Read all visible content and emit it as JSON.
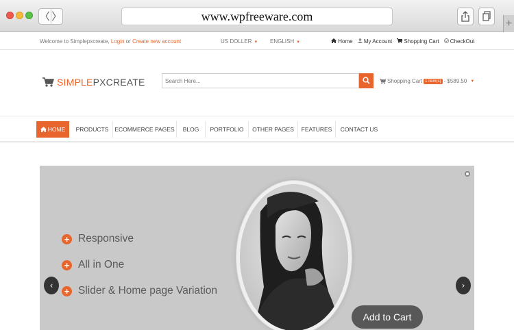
{
  "browser": {
    "url": "www.wpfreeware.com",
    "back": "〈",
    "forward": "〉",
    "new_tab": "+"
  },
  "topbar": {
    "welcome": "Welcome to Simplepxcreate,",
    "login": "Login",
    "or": "or",
    "create_account": "Create new account",
    "currency": "US DOLLER",
    "language": "ENGLISH",
    "links": [
      {
        "label": "Home",
        "icon": "home-icon"
      },
      {
        "label": "My Account",
        "icon": "user-icon"
      },
      {
        "label": "Shopping Cart",
        "icon": "cart-icon"
      },
      {
        "label": "CheckOut",
        "icon": "check-icon"
      }
    ]
  },
  "header": {
    "logo_part1": "SIMPLE",
    "logo_part2": "PXCREATE",
    "search_placeholder": "Search Here...",
    "cart_label": "Shopping Cart",
    "cart_count": "1 item(s)",
    "cart_total": "- $589.50"
  },
  "nav": {
    "items": [
      "HOME",
      "PRODUCTS",
      "ECOMMERCE PAGES",
      "BLOG",
      "PORTFOLIO",
      "OTHER PAGES",
      "FEATURES",
      "CONTACT US"
    ]
  },
  "slider": {
    "features": [
      "Responsive",
      "All in One",
      "Slider & Home page Variation"
    ],
    "add_to_cart": "Add to Cart",
    "prev": "‹",
    "next": "›"
  },
  "colors": {
    "accent": "#e8652d",
    "slider_bg": "#c9c9c9"
  }
}
